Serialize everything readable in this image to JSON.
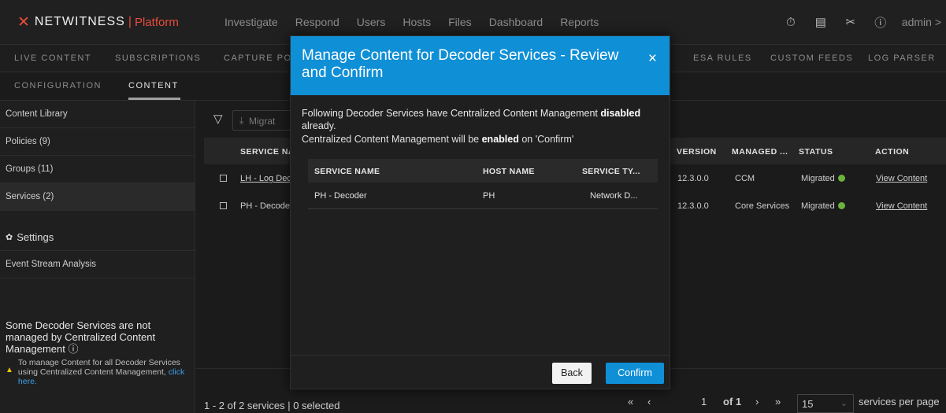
{
  "topbar": {
    "brand": "NETWITNESS",
    "separator": "|",
    "platform": "Platform",
    "nav": [
      "Investigate",
      "Respond",
      "Users",
      "Hosts",
      "Files",
      "Dashboard",
      "Reports"
    ],
    "icons": [
      "stopwatch-icon",
      "report-icon",
      "tools-icon",
      "help-icon"
    ],
    "admin": "admin >"
  },
  "subbar": {
    "live_content": "LIVE CONTENT",
    "subscriptions": "SUBSCRIPTIONS",
    "capture_policy": "CAPTURE PO",
    "esa_rules": "ESA RULES",
    "custom_feeds": "CUSTOM FEEDS",
    "log_parser": "LOG PARSER"
  },
  "tabs": {
    "configuration": "CONFIGURATION",
    "content": "CONTENT"
  },
  "sidebar": {
    "items": [
      "Content Library",
      "Policies (9)",
      "Groups (11)",
      "Services (2)"
    ],
    "settings": "Settings",
    "event_stream": "Event Stream Analysis",
    "notice_title": "Some Decoder Services are not managed by Centralized Content Management",
    "notice_msg": "To manage Content for all Decoder Services using Centralized Content Management,",
    "notice_link": "click here."
  },
  "main": {
    "migrate_label": "Migrat",
    "headers": {
      "service_name": "SERVICE NA",
      "version": "VERSION",
      "managed": "MANAGED ...",
      "status": "STATUS",
      "action": "ACTION"
    },
    "rows": [
      {
        "name": "LH - Log Dec",
        "version": "12.3.0.0",
        "managed": "CCM",
        "status": "Migrated",
        "action": "View Content"
      },
      {
        "name": "PH - Decode",
        "version": "12.3.0.0",
        "managed": "Core Services",
        "status": "Migrated",
        "action": "View Content"
      }
    ],
    "footer_left": "1 - 2 of 2 services | 0 selected",
    "page_first": "«",
    "page_prev": "‹",
    "page_current": "1",
    "page_of": "of 1",
    "page_next": "›",
    "page_last": "»",
    "per_page_value": "15",
    "per_page_label": "services per page"
  },
  "modal": {
    "title": "Manage Content for Decoder Services - Review and Confirm",
    "close": "×",
    "msg1_pre": "Following Decoder Services have Centralized Content Management ",
    "msg1_bold": "disabled",
    "msg1_post": " already.",
    "msg2_pre": "Centralized Content Management will be ",
    "msg2_bold": "enabled",
    "msg2_post": " on 'Confirm'",
    "headers": {
      "service_name": "SERVICE NAME",
      "host_name": "HOST NAME",
      "service_type": "SERVICE TY..."
    },
    "rows": [
      {
        "service_name": "PH - Decoder",
        "host_name": "PH",
        "service_type": "Network D..."
      }
    ],
    "back": "Back",
    "confirm": "Confirm"
  }
}
